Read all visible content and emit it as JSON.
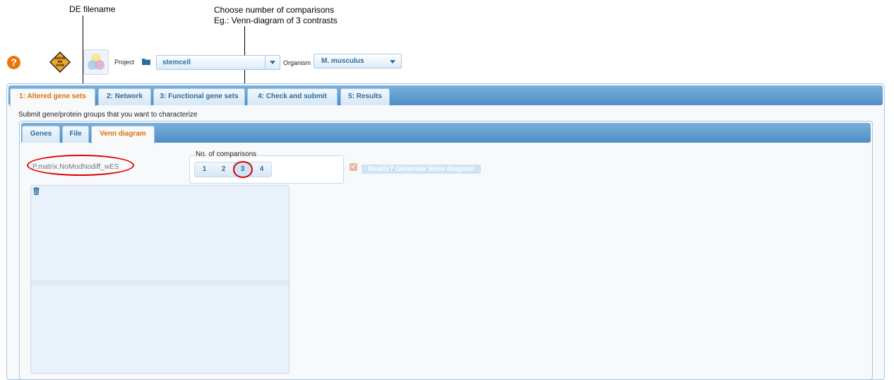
{
  "annotations": {
    "de_filename": "DE filename",
    "choose_line1": "Choose number of comparisons",
    "choose_line2": "Eg.: Venn-diagram of 3 contrasts"
  },
  "header": {
    "help_glyph": "?",
    "showme_line1": "SHOW",
    "showme_line2": "ME",
    "showme_line3": "HOW",
    "project_label": "Project",
    "project_value": "stemcell",
    "organism_label": "Organism",
    "organism_value": "M. musculus"
  },
  "main_tabs": [
    {
      "label": "1: Altered gene sets",
      "active": true
    },
    {
      "label": "2: Network",
      "active": false
    },
    {
      "label": "3: Functional gene sets",
      "active": false
    },
    {
      "label": "4: Check and submit",
      "active": false
    },
    {
      "label": "5: Results",
      "active": false
    }
  ],
  "subtitle": "Submit gene/protein groups that you want to characterize",
  "sub_tabs": [
    {
      "label": "Genes",
      "active": false
    },
    {
      "label": "File",
      "active": false
    },
    {
      "label": "Venn diagram",
      "active": true
    }
  ],
  "venn": {
    "de_input_placeholder": "P.matrix.NoModNodiff_wES",
    "comparisons_legend": "No. of comparisons",
    "comparison_options": [
      "1",
      "2",
      "3",
      "4"
    ],
    "selected_comparison": "3",
    "ready_checked": true,
    "generate_label": "Ready? Generate Venn diagram"
  },
  "colors": {
    "accent_orange": "#e17009",
    "tab_text_blue": "#2e6e9e",
    "annotation_red": "#e00000"
  }
}
